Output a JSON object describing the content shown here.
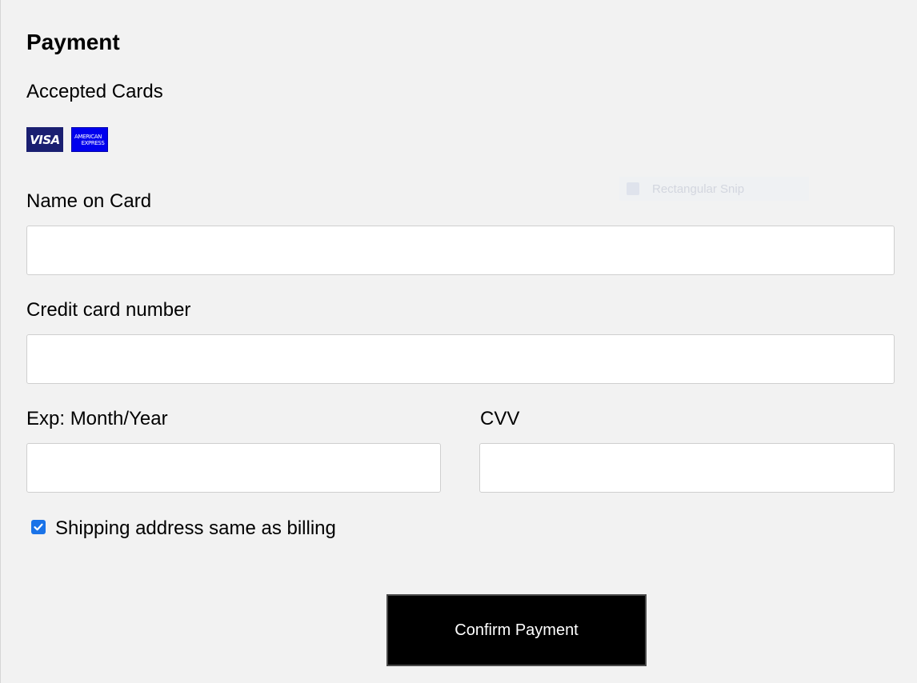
{
  "form": {
    "title": "Payment",
    "accepted_cards_label": "Accepted Cards",
    "cards": {
      "visa": "VISA",
      "amex_line1": "AMERICAN",
      "amex_line2": "EXPRESS"
    },
    "name_label": "Name on Card",
    "name_value": "",
    "card_number_label": "Credit card number",
    "card_number_value": "",
    "exp_label": "Exp: Month/Year",
    "exp_value": "",
    "cvv_label": "CVV",
    "cvv_value": "",
    "shipping_checkbox_label": "Shipping address same as billing",
    "shipping_checked": true,
    "confirm_button": "Confirm Payment"
  },
  "overlay": {
    "snip_label": "Rectangular Snip"
  },
  "colors": {
    "background": "#f2f2f2",
    "button": "#000000",
    "checkbox": "#1a73e8",
    "visa": "#1a1f71",
    "amex": "#0000ee"
  }
}
